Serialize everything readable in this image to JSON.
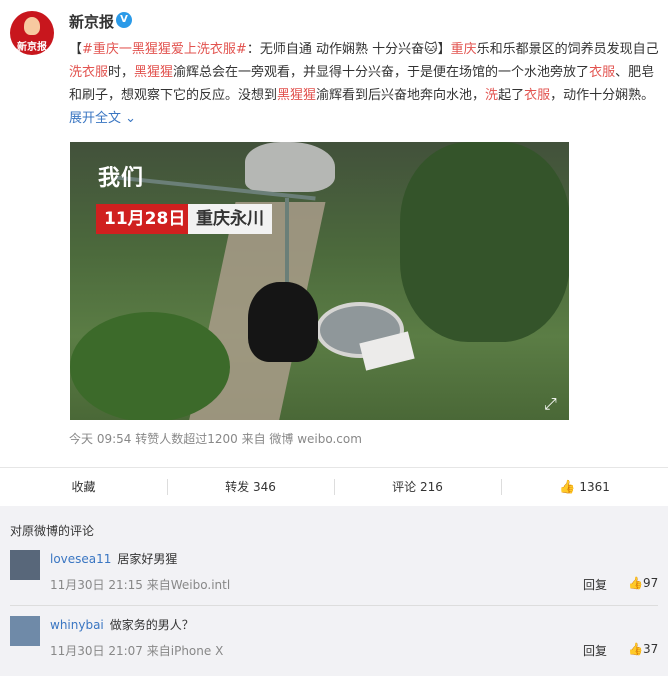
{
  "post": {
    "username": "新京报",
    "avatar_text": "新京报",
    "content_parts": [
      {
        "text": "【",
        "hl": false
      },
      {
        "text": "#重庆一黑猩猩爱上洗衣服#",
        "hl": true
      },
      {
        "text": "：无师自通 动作娴熟 十分兴奋",
        "hl": false
      },
      {
        "text": "🐱",
        "hl": false
      },
      {
        "text": "】",
        "hl": false
      },
      {
        "text": "重庆",
        "hl": true
      },
      {
        "text": "乐和乐都景区的饲养员发现自己",
        "hl": false
      },
      {
        "text": "洗衣服",
        "hl": true
      },
      {
        "text": "时，",
        "hl": false
      },
      {
        "text": "黑猩猩",
        "hl": true
      },
      {
        "text": "渝辉总会在一旁观看，并显得十分兴奋，于是便在场馆的一个水池旁放了",
        "hl": false
      },
      {
        "text": "衣服",
        "hl": true
      },
      {
        "text": "、肥皂和刷子，想观察下它的反应。没想到",
        "hl": false
      },
      {
        "text": "黑猩猩",
        "hl": true
      },
      {
        "text": "渝辉看到后兴奋地奔向水池，",
        "hl": false
      },
      {
        "text": "洗",
        "hl": true
      },
      {
        "text": "起了",
        "hl": false
      },
      {
        "text": "衣服",
        "hl": true
      },
      {
        "text": "，动作十分娴熟。 ",
        "hl": false
      }
    ],
    "expand_label": "展开全文",
    "video": {
      "logo": "我们",
      "date": "11月28日",
      "place": "重庆永川"
    },
    "meta": "今天 09:54 转赞人数超过1200  来自 微博 weibo.com"
  },
  "actions": {
    "favorite": "收藏",
    "repost": "转发 346",
    "comment": "评论 216",
    "like": "1361"
  },
  "comments": {
    "header": "对原微博的评论",
    "items": [
      {
        "user": "lovesea11",
        "text": "居家好男猩",
        "time": "11月30日 21:15 来自Weibo.intl",
        "reply": "回复",
        "likes": "97"
      },
      {
        "user": "whinybai",
        "text": "做家务的男人？",
        "time": "11月30日 21:07 来自iPhone X",
        "reply": "回复",
        "likes": "37"
      }
    ]
  }
}
